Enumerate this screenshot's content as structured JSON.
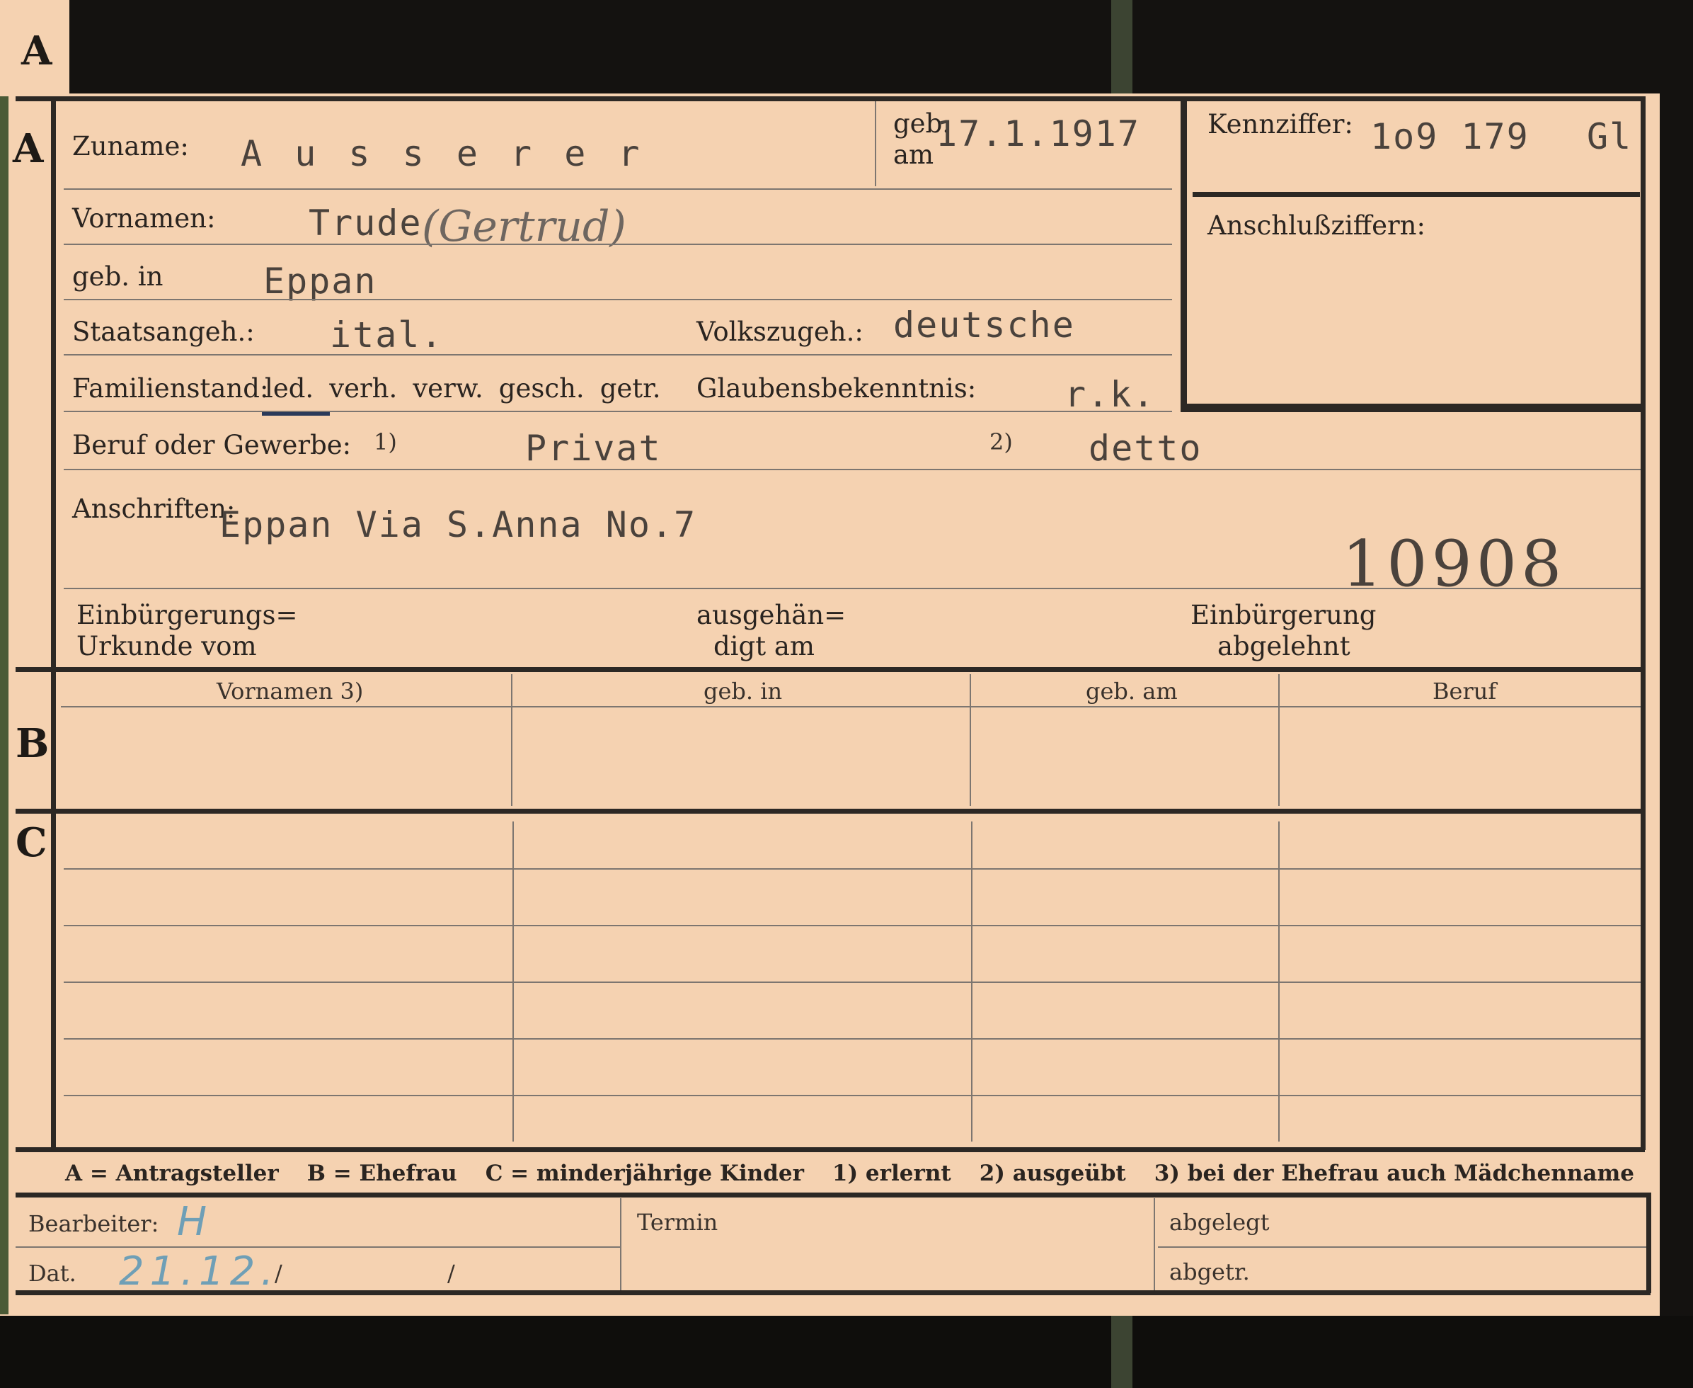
{
  "tab_letter": "A",
  "section_labels": {
    "a": "A",
    "b": "B",
    "c": "C"
  },
  "section_a": {
    "zuname_label": "Zuname:",
    "zuname_value": "A u s s e r e r",
    "geb_am_label_1": "geb.",
    "geb_am_label_2": "am",
    "geb_am_value": "17.1.1917",
    "kennziffer_label": "Kennziffer:",
    "kennziffer_value": "1o9 179",
    "kennziffer_suffix": "Gl",
    "anschluss_label": "Anschlußziffern:",
    "vornamen_label": "Vornamen:",
    "vornamen_value": "Trude",
    "vornamen_handwritten": "(Gertrud)",
    "geb_in_label": "geb. in",
    "geb_in_value": "Eppan",
    "staat_label": "Staatsangeh.:",
    "staat_value": "ital.",
    "volk_label": "Volkszugeh.:",
    "volk_value": "deutsche",
    "familienstand_label": "Familienstand:",
    "familienstand_options": [
      "led.",
      "verh.",
      "verw.",
      "gesch.",
      "getr."
    ],
    "familienstand_selected": "led.",
    "glauben_label": "Glaubensbekenntnis:",
    "glauben_value": "r.k.",
    "beruf_label": "Beruf oder Gewerbe:",
    "beruf_mark_1": "1)",
    "beruf_value_1": "Privat",
    "beruf_mark_2": "2)",
    "beruf_value_2": "detto",
    "anschriften_label": "Anschriften:",
    "anschriften_value": "Eppan Via S.Anna No.7",
    "stamp_number": "10908",
    "einbuergerung_label_1": "Einbürgerungs=",
    "einbuergerung_label_2": "Urkunde vom",
    "ausgehaendigt_label_1": "ausgehän=",
    "ausgehaendigt_label_2": "digt am",
    "abgelehnt_label_1": "Einbürgerung",
    "abgelehnt_label_2": "abgelehnt"
  },
  "section_b": {
    "columns": [
      "Vornamen 3)",
      "geb. in",
      "geb. am",
      "Beruf"
    ]
  },
  "legend": {
    "a": "A = Antragsteller",
    "b": "B = Ehefrau",
    "c": "C = minderjährige Kinder",
    "n1": "1) erlernt",
    "n2": "2) ausgeübt",
    "n3": "3) bei der Ehefrau auch Mädchenname"
  },
  "footer": {
    "bearbeiter_label": "Bearbeiter:",
    "bearbeiter_value": "H",
    "termin_label": "Termin",
    "abgelegt_label": "abgelegt",
    "dat_label": "Dat.",
    "dat_value": "21.12.",
    "dat_slash_1": "/",
    "dat_slash_2": "/",
    "abgetr_label": "abgetr."
  }
}
